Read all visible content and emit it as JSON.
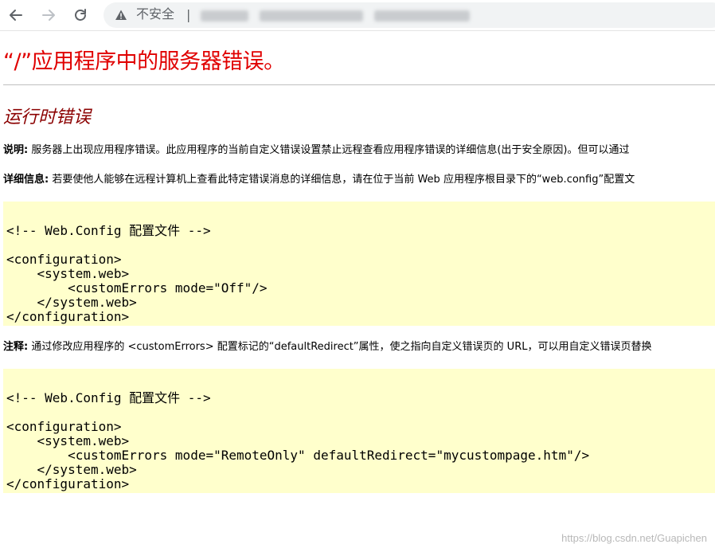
{
  "browser": {
    "security_label": "不安全",
    "separator": "|"
  },
  "page": {
    "title": "“/”应用程序中的服务器错误。",
    "subtitle": "运行时错误",
    "description_label": "说明:",
    "description_text": " 服务器上出现应用程序错误。此应用程序的当前自定义错误设置禁止远程查看应用程序错误的详细信息(出于安全原因)。但可以通过",
    "details_label": "详细信息:",
    "details_text": " 若要使他人能够在远程计算机上查看此特定错误消息的详细信息，请在位于当前 Web 应用程序根目录下的“web.config”配置文",
    "code1": "\n<!-- Web.Config 配置文件 -->\n\n<configuration>\n    <system.web>\n        <customErrors mode=\"Off\"/>\n    </system.web>\n</configuration>",
    "note_label": "注释:",
    "note_text": " 通过修改应用程序的 <customErrors> 配置标记的“defaultRedirect”属性，使之指向自定义错误页的 URL，可以用自定义错误页替换",
    "code2": "\n<!-- Web.Config 配置文件 -->\n\n<configuration>\n    <system.web>\n        <customErrors mode=\"RemoteOnly\" defaultRedirect=\"mycustompage.htm\"/>\n    </system.web>\n</configuration>"
  },
  "watermark": "https://blog.csdn.net/Guapichen",
  "colors": {
    "title_red": "#e00000",
    "subtitle_maroon": "#8b0000",
    "code_bg": "#ffffcc"
  }
}
